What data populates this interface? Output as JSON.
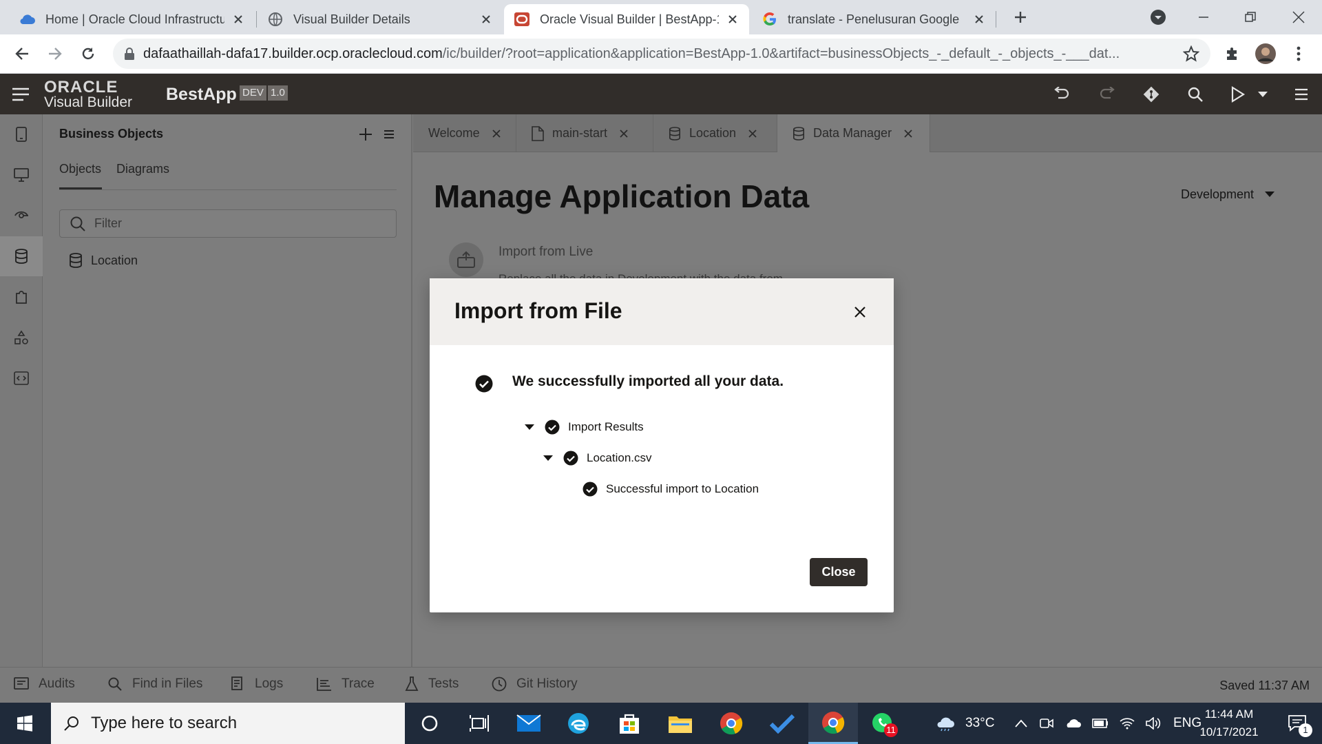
{
  "browser": {
    "tabs": [
      {
        "title": "Home | Oracle Cloud Infrastructu",
        "favicon": "cloud-icon"
      },
      {
        "title": "Visual Builder Details",
        "favicon": "globe-icon"
      },
      {
        "title": "Oracle Visual Builder | BestApp-1",
        "favicon": "oracle-icon",
        "active": true
      },
      {
        "title": "translate - Penelusuran Google",
        "favicon": "google-icon"
      }
    ],
    "url_host": "dafaathaillah-dafa17.builder.ocp.oraclecloud.com",
    "url_path": "/ic/builder/?root=application&application=BestApp-1.0&artifact=businessObjects_-_default_-_objects_-___dat..."
  },
  "vb": {
    "brand_top": "ORACLE",
    "brand_sub": "Visual Builder",
    "app_name": "BestApp",
    "badge_dev": "DEV",
    "badge_version": "1.0"
  },
  "panel": {
    "title": "Business Objects",
    "tab_objects": "Objects",
    "tab_diagrams": "Diagrams",
    "filter_placeholder": "Filter",
    "items": [
      {
        "label": "Location"
      }
    ]
  },
  "editor_tabs": [
    {
      "label": "Welcome"
    },
    {
      "label": "main-start"
    },
    {
      "label": "Location"
    },
    {
      "label": "Data Manager",
      "active": true
    }
  ],
  "main": {
    "title": "Manage Application Data",
    "environment": "Development",
    "live_card_title": "Import from Live",
    "live_card_desc": "Replace all the data in Development with the data from..."
  },
  "modal": {
    "title": "Import from File",
    "message": "We successfully imported all your data.",
    "tree": {
      "root": "Import Results",
      "file": "Location.csv",
      "result": "Successful import to Location"
    },
    "close_label": "Close"
  },
  "statusbar": {
    "audits": "Audits",
    "find": "Find in Files",
    "logs": "Logs",
    "trace": "Trace",
    "tests": "Tests",
    "git": "Git History",
    "saved": "Saved 11:37 AM"
  },
  "taskbar": {
    "search_placeholder": "Type here to search",
    "weather": "33°C",
    "lang": "ENG",
    "time": "11:44 AM",
    "date": "10/17/2021",
    "whatsapp_badge": "11",
    "notif_count": "1"
  },
  "colors": {
    "vb_header": "#312d2a",
    "modal_head": "#f1efed",
    "button_dark": "#312d2a",
    "overlay_bg": "#7d7d7d"
  }
}
